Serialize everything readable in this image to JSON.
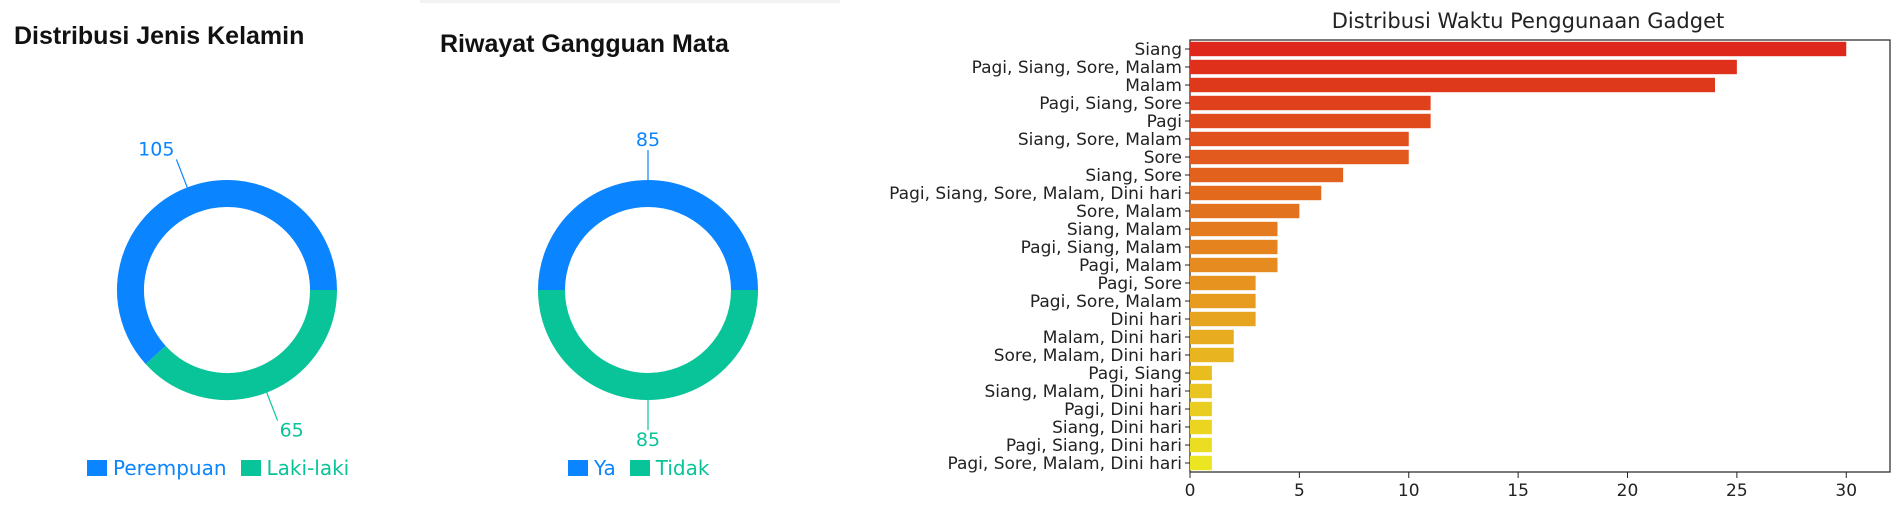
{
  "colors": {
    "primary": "#0a84ff",
    "secondary": "#0ac499"
  },
  "chart_data": [
    {
      "type": "pie",
      "title": "Distribusi Jenis Kelamin",
      "labels": [
        "Perempuan",
        "Laki-laki"
      ],
      "values": [
        105,
        65
      ],
      "colors": [
        "#0a84ff",
        "#0ac499"
      ],
      "legend": "bottom"
    },
    {
      "type": "pie",
      "title": "Riwayat Gangguan Mata",
      "labels": [
        "Ya",
        "Tidak"
      ],
      "values": [
        85,
        85
      ],
      "colors": [
        "#0a84ff",
        "#0ac499"
      ],
      "legend": "bottom"
    },
    {
      "type": "bar",
      "orientation": "horizontal",
      "title": "Distribusi Waktu Penggunaan Gadget",
      "categories": [
        "Siang",
        "Pagi, Siang, Sore, Malam",
        "Malam",
        "Pagi, Siang, Sore",
        "Pagi",
        "Siang, Sore, Malam",
        "Sore",
        "Siang, Sore",
        "Pagi, Siang, Sore, Malam, Dini hari",
        "Sore, Malam",
        "Siang, Malam",
        "Pagi, Siang, Malam",
        "Pagi, Malam",
        "Pagi, Sore",
        "Pagi, Sore, Malam",
        "Dini hari",
        "Malam, Dini hari",
        "Sore, Malam, Dini hari",
        "Pagi, Siang",
        "Siang, Malam, Dini hari",
        "Pagi, Dini hari",
        "Siang, Dini hari",
        "Pagi, Siang, Dini hari",
        "Pagi, Sore, Malam, Dini hari"
      ],
      "values": [
        30,
        25,
        24,
        11,
        11,
        10,
        10,
        7,
        6,
        5,
        4,
        4,
        4,
        3,
        3,
        3,
        2,
        2,
        1,
        1,
        1,
        1,
        1,
        1
      ],
      "xlim": [
        0,
        32
      ],
      "xticks": [
        0,
        5,
        10,
        15,
        20,
        25,
        30
      ],
      "xlabel": "",
      "ylabel": "",
      "palette": "autumn (red to yellow)",
      "grid": false
    }
  ]
}
